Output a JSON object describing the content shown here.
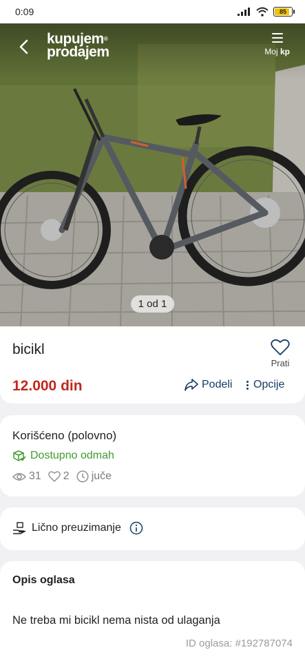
{
  "status_bar": {
    "time": "0:09",
    "battery": "85"
  },
  "header": {
    "logo_line1": "kupujem",
    "logo_line2": "prodajem",
    "logo_mark": "®",
    "menu_label_prefix": "Moj ",
    "menu_label_bold": "kp"
  },
  "gallery": {
    "counter": "1 od 1"
  },
  "listing": {
    "title": "bicikl",
    "follow_label": "Prati",
    "price": "12.000 din",
    "share_label": "Podeli",
    "options_label": "Opcije"
  },
  "status": {
    "condition": "Korišćeno (polovno)",
    "availability": "Dostupno odmah",
    "views": "31",
    "favorites": "2",
    "posted": "juče"
  },
  "delivery": {
    "label": "Lično preuzimanje"
  },
  "description": {
    "heading": "Opis oglasa",
    "text": "Ne treba mi bicikl nema nista od ulaganja",
    "ad_id": "ID oglasa: #192787074"
  },
  "colors": {
    "price": "#c0281d",
    "available": "#3f9b2c",
    "link": "#163a66"
  }
}
